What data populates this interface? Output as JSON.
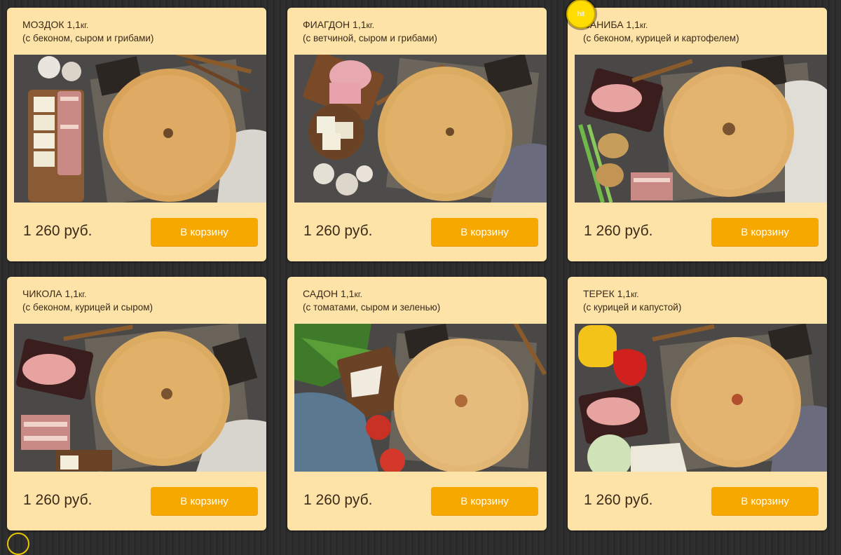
{
  "products": [
    {
      "name": "МОЗДОК 1,1",
      "unit": "кг.",
      "desc": "(с беконом, сыром и грибами)",
      "price": "1 260 руб.",
      "button": "В корзину"
    },
    {
      "name": "ФИАГДОН 1,1",
      "unit": "кг.",
      "desc": "(с ветчиной, сыром и грибами)",
      "price": "1 260 руб.",
      "button": "В корзину"
    },
    {
      "name": "САНИБА 1,1",
      "unit": "кг.",
      "desc": "(с беконом, курицей и картофелем)",
      "price": "1 260 руб.",
      "button": "В корзину"
    },
    {
      "name": "ЧИКОЛА 1,1",
      "unit": "кг.",
      "desc": "(с беконом, курицей и сыром)",
      "price": "1 260 руб.",
      "button": "В корзину"
    },
    {
      "name": "САДОН 1,1",
      "unit": "кг.",
      "desc": "(с томатами, сыром и зеленью)",
      "price": "1 260 руб.",
      "button": "В корзину"
    },
    {
      "name": "ТЕРЕК 1,1",
      "unit": "кг.",
      "desc": "(с курицей и капустой)",
      "price": "1 260 руб.",
      "button": "В корзину"
    }
  ],
  "badge": {
    "label": "hit"
  },
  "colors": {
    "card": "#fde3a8",
    "button": "#f6a800",
    "text": "#3a2a1a",
    "badge": "#ffdd00"
  }
}
